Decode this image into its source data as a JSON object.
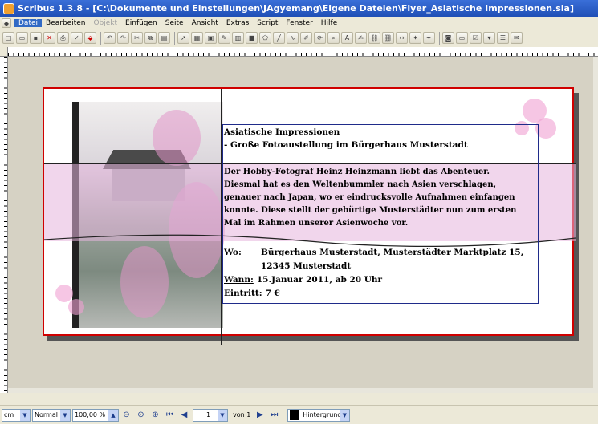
{
  "window": {
    "title": "Scribus 1.3.8 - [C:\\Dokumente und Einstellungen\\JAgyemang\\Eigene Dateien\\Flyer_Asiatische Impressionen.sla]"
  },
  "menu": {
    "items": [
      "Datei",
      "Bearbeiten",
      "Objekt",
      "Einfügen",
      "Seite",
      "Ansicht",
      "Extras",
      "Script",
      "Fenster",
      "Hilfe"
    ]
  },
  "document": {
    "heading_line1": "Asiatische Impressionen",
    "heading_line2": "- Große Fotoaustellung im Bürgerhaus Musterstadt",
    "body_lines": [
      "Der Hobby-Fotograf Heinz Heinzmann liebt das Abenteuer.",
      "Diesmal hat es den Weltenbummler nach Asien verschlagen,",
      "genauer nach Japan, wo er eindrucksvolle Aufnahmen einfangen",
      "konnte. Diese stellt der gebürtige Musterstädter nun zum ersten",
      "Mal im Rahmen unserer Asienwoche vor."
    ],
    "where_label": "Wo:",
    "where_value_line1": "Bürgerhaus Musterstadt, Musterstädter Marktplatz 15,",
    "where_value_line2": "12345 Musterstadt",
    "when_label": "Wann:",
    "when_value": "15.Januar 2011, ab 20 Uhr",
    "entry_label": "Eintritt:",
    "entry_value": "7 €"
  },
  "statusbar": {
    "unit": "cm",
    "mode": "Normal",
    "zoom": "100,00 %",
    "page_number": "1",
    "page_of": "von 1",
    "layer": "Hintergrund"
  },
  "colors": {
    "accent": "#316ac5",
    "page_border": "#d00000",
    "text_frame": "#1f2b8a",
    "band": "#e6b4dc"
  }
}
